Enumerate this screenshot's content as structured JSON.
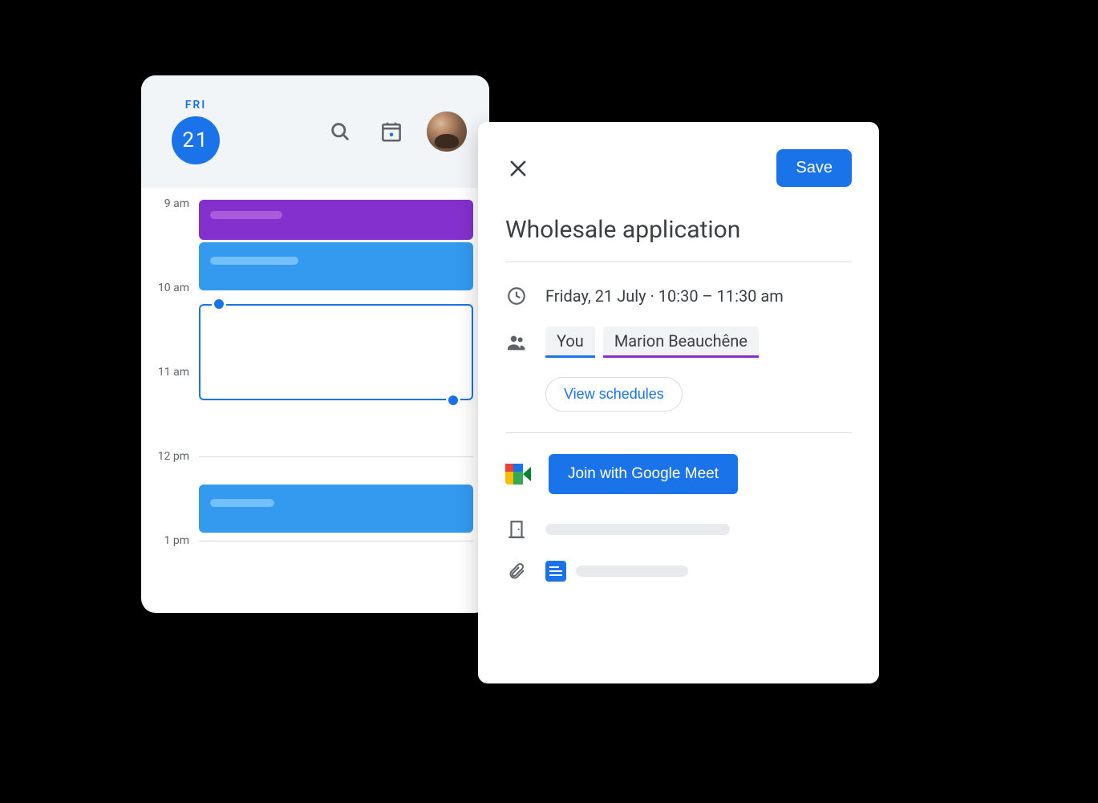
{
  "calendar": {
    "day_label": "FRI",
    "day_number": "21",
    "hours": [
      "9 am",
      "10 am",
      "11 am",
      "12 pm",
      "1 pm"
    ]
  },
  "event": {
    "save_label": "Save",
    "title": "Wholesale application",
    "date": "Friday, 21 July",
    "time": "10:30 – 11:30 am",
    "attendees": {
      "you": "You",
      "other": "Marion Beauchêne"
    },
    "view_schedules_label": "View schedules",
    "meet_label": "Join with Google Meet"
  }
}
